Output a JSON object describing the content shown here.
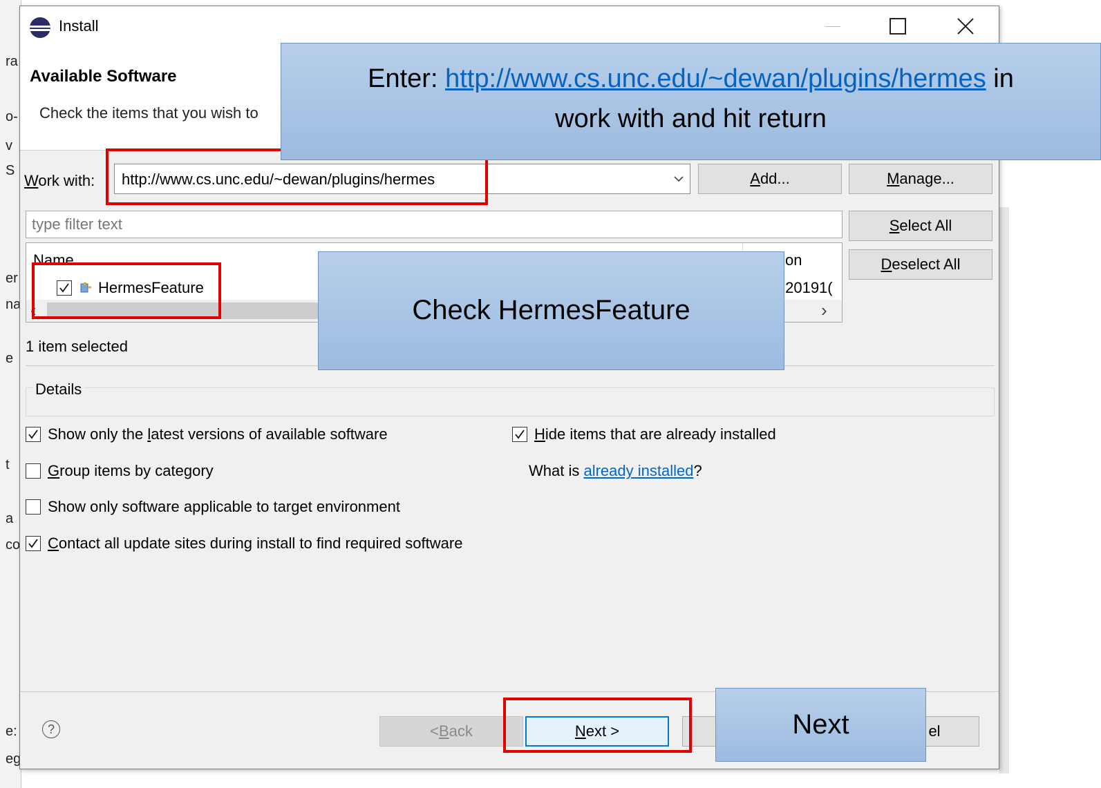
{
  "bg_window": {
    "frags": [
      "ra",
      "o-",
      "v",
      "S",
      "er",
      "na",
      "e",
      "t",
      "a",
      "co",
      "e:",
      "eg"
    ]
  },
  "dialog": {
    "title": "Install",
    "header": {
      "title": "Available Software",
      "description": "Check the items that you wish to"
    },
    "work_with": {
      "label_prefix": "W",
      "label_rest": "ork with:",
      "value": "http://www.cs.unc.edu/~dewan/plugins/hermes",
      "add_button": {
        "u": "A",
        "rest": "dd..."
      },
      "manage_button": {
        "u": "M",
        "rest": "anage..."
      }
    },
    "filter": {
      "placeholder": "type filter text"
    },
    "select_all": {
      "u": "S",
      "rest": "elect All"
    },
    "deselect_all": {
      "u": "D",
      "rest": "eselect All"
    },
    "table": {
      "col_name": "Name",
      "col_version_partial": "on",
      "row": {
        "name": "HermesFeature",
        "version_partial": ".20191(",
        "checked": true
      },
      "scroll_left": "‹",
      "scroll_right": "›"
    },
    "selection_status": "1 item selected",
    "details_label": "Details",
    "options": [
      {
        "pre": "Show only the ",
        "u": "l",
        "post": "atest versions of available software",
        "checked": true
      },
      {
        "pre": "",
        "u": "G",
        "post": "roup items by category",
        "checked": false
      },
      {
        "pre": "Show only software applicable to target environment",
        "u": "",
        "post": "",
        "checked": false
      },
      {
        "pre": "",
        "u": "C",
        "post": "ontact all update sites during install to find required software",
        "checked": true
      }
    ],
    "hide_installed": {
      "pre": "",
      "u": "H",
      "post": "ide items that are already installed",
      "checked": true
    },
    "what_is": {
      "pre": "What is ",
      "link": "already installed",
      "post": "?"
    },
    "footer": {
      "help": "?",
      "back": {
        "pre": "< ",
        "u": "B",
        "rest": "ack"
      },
      "next": {
        "u": "N",
        "rest": "ext >"
      },
      "cancel_partial": "el"
    }
  },
  "callouts": {
    "top": {
      "prefix": "Enter: ",
      "url": "http://www.cs.unc.edu/~dewan/plugins/hermes",
      "suffix": " in",
      "line2": "work with and hit return"
    },
    "middle": "Check HermesFeature",
    "next": "Next"
  },
  "colors": {
    "callout_fill": "#a9c5e6",
    "highlight_red": "#e00000",
    "link_blue": "#0066cc"
  }
}
